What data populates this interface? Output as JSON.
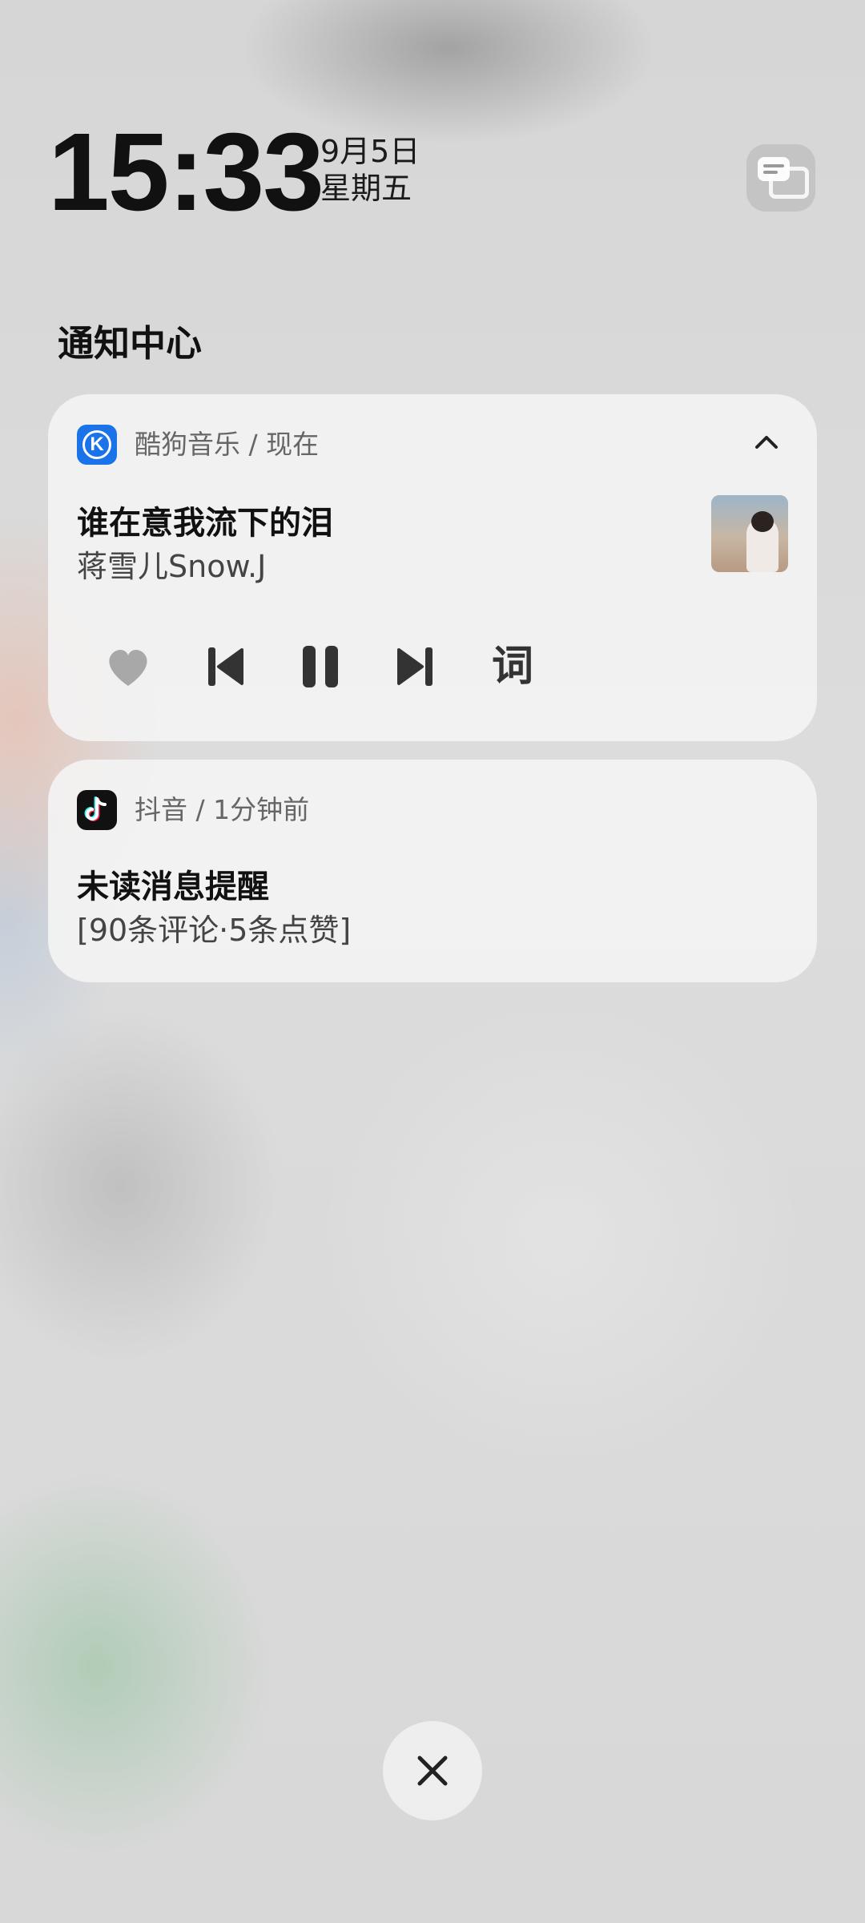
{
  "lockscreen": {
    "time": "15:33",
    "date": "9月5日",
    "weekday": "星期五"
  },
  "notification_center": {
    "title": "通知中心"
  },
  "notifications": [
    {
      "app": "酷狗音乐",
      "header": "酷狗音乐 / 现在",
      "song_title": "谁在意我流下的泪",
      "artist": "蒋雪儿Snow.J",
      "controls": {
        "like": "heart-icon",
        "previous": "skip-previous-icon",
        "play_pause": "pause-icon",
        "next": "skip-next-icon",
        "lyrics_label": "词"
      },
      "brand_color": "#1a73e8"
    },
    {
      "app": "抖音",
      "header": "抖音 / 1分钟前",
      "title": "未读消息提醒",
      "body": "[90条评论·5条点赞]",
      "brand_color": "#111111"
    }
  ],
  "icons": {
    "top_right": "message-stack-icon",
    "collapse": "chevron-up-icon",
    "close": "close-icon"
  }
}
